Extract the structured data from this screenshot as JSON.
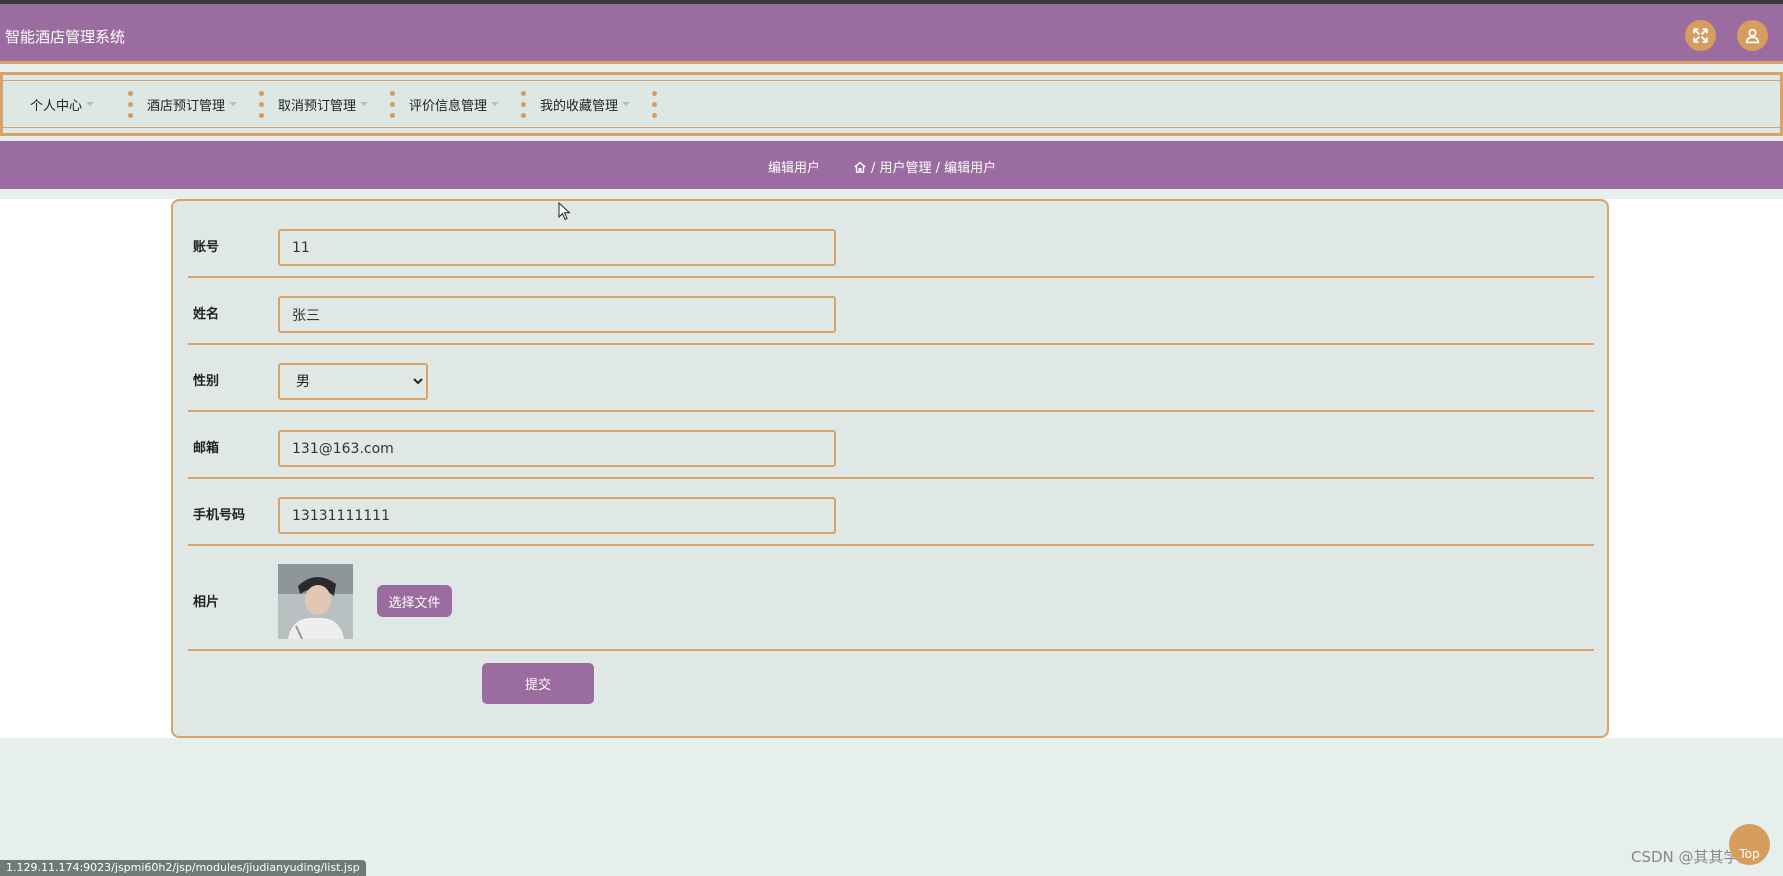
{
  "header": {
    "app_title": "智能酒店管理系统",
    "fullscreen_icon": "expand-icon",
    "user_icon": "user-icon"
  },
  "nav": {
    "items": [
      {
        "label": "个人中心"
      },
      {
        "label": "酒店预订管理"
      },
      {
        "label": "取消预订管理"
      },
      {
        "label": "评价信息管理"
      },
      {
        "label": "我的收藏管理"
      }
    ]
  },
  "breadcrumb": {
    "page_title": "编辑用户",
    "home_icon": "home-icon",
    "path": "/ 用户管理 / 编辑用户"
  },
  "form": {
    "account": {
      "label": "账号",
      "value": "11"
    },
    "name": {
      "label": "姓名",
      "value": "张三"
    },
    "gender": {
      "label": "性别",
      "value": "男"
    },
    "email": {
      "label": "邮箱",
      "value": "131@163.com"
    },
    "phone": {
      "label": "手机号码",
      "value": "13131111111"
    },
    "photo": {
      "label": "相片",
      "choose_file_label": "选择文件"
    },
    "submit_label": "提交"
  },
  "statusbar": {
    "url": "1.129.11.174:9023/jspmi60h2/jsp/modules/jiudianyuding/list.jsp"
  },
  "watermark": "CSDN @其其学姐",
  "top_button": "Top",
  "colors": {
    "primary": "#9a6c9f",
    "accent": "#d8a36a",
    "background": "#dfe8e4"
  }
}
